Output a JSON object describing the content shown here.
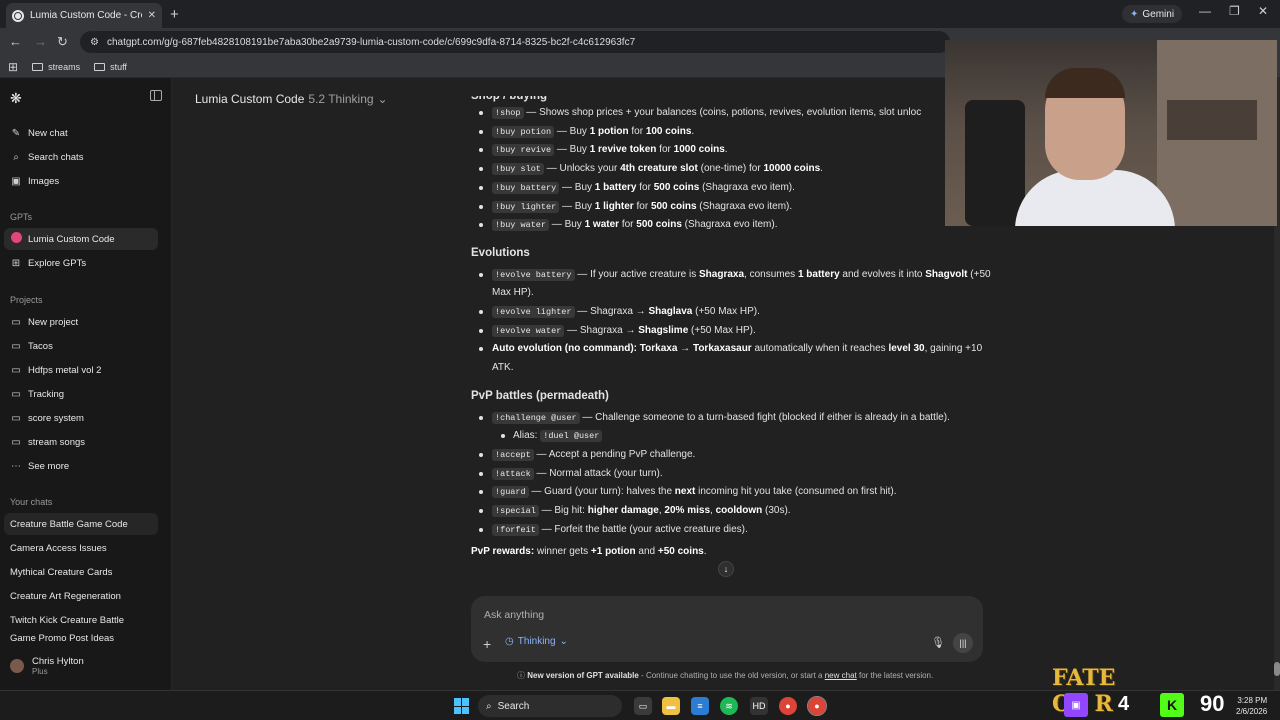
{
  "browser": {
    "tab_title": "Lumia Custom Code - Creature",
    "url": "chatgpt.com/g/g-687feb4828108191be7aba30be2a9739-lumia-custom-code/c/699c9dfa-8714-8325-bc2f-c4c612963fc7",
    "gemini_label": "Gemini",
    "bookmarks": [
      {
        "label": "streams",
        "icon": "folder-icon"
      },
      {
        "label": "stuff",
        "icon": "folder-icon"
      }
    ]
  },
  "sidebar": {
    "top_items": [
      {
        "label": "New chat",
        "icon": "edit-icon"
      },
      {
        "label": "Search chats",
        "icon": "search-icon"
      },
      {
        "label": "Images",
        "icon": "image-icon"
      }
    ],
    "gpts_header": "GPTs",
    "gpts": [
      {
        "label": "Lumia Custom Code",
        "icon": "lumia-icon"
      },
      {
        "label": "Explore GPTs",
        "icon": "grid-icon"
      }
    ],
    "projects_header": "Projects",
    "projects": [
      {
        "label": "New project",
        "icon": "folder-plus-icon"
      },
      {
        "label": "Tacos",
        "icon": "folder-icon"
      },
      {
        "label": "Hdfps metal vol 2",
        "icon": "folder-icon"
      },
      {
        "label": "Tracking",
        "icon": "folder-icon"
      },
      {
        "label": "score system",
        "icon": "folder-icon"
      },
      {
        "label": "stream songs",
        "icon": "folder-icon"
      },
      {
        "label": "See more",
        "icon": "more-icon"
      }
    ],
    "chats_header": "Your chats",
    "chats": [
      "Creature Battle Game Code",
      "Camera Access Issues",
      "Mythical Creature Cards",
      "Creature Art Regeneration",
      "Twitch Kick Creature Battle",
      "Game Promo Post Ideas"
    ],
    "user": {
      "name": "Chris Hylton",
      "plan": "Plus"
    }
  },
  "header": {
    "model_name": "Lumia Custom Code",
    "model_version": "5.2 Thinking"
  },
  "content": {
    "cut_heading": "Shop / buying",
    "shop": [
      {
        "cmd": "!shop",
        "text": " — Shows shop prices + your balances (coins, potions, revives, evolution items, slot unloc"
      },
      {
        "cmd": "!buy potion",
        "pre": " — Buy ",
        "b1": "1 potion",
        "mid": " for ",
        "b2": "100 coins",
        "post": "."
      },
      {
        "cmd": "!buy revive",
        "pre": " — Buy ",
        "b1": "1 revive token",
        "mid": " for ",
        "b2": "1000 coins",
        "post": "."
      },
      {
        "cmd": "!buy slot",
        "pre": " — Unlocks your ",
        "b1": "4th creature slot",
        "mid": " (one-time) for ",
        "b2": "10000 coins",
        "post": "."
      },
      {
        "cmd": "!buy battery",
        "pre": " — Buy ",
        "b1": "1 battery",
        "mid": " for ",
        "b2": "500 coins",
        "post": " (Shagraxa evo item)."
      },
      {
        "cmd": "!buy lighter",
        "pre": " — Buy ",
        "b1": "1 lighter",
        "mid": " for ",
        "b2": "500 coins",
        "post": " (Shagraxa evo item)."
      },
      {
        "cmd": "!buy water",
        "pre": " — Buy ",
        "b1": "1 water",
        "mid": " for ",
        "b2": "500 coins",
        "post": " (Shagraxa evo item)."
      }
    ],
    "evolutions_heading": "Evolutions",
    "evolutions": [
      {
        "cmd": "!evolve battery",
        "pre": " — If your active creature is ",
        "b1": "Shagraxa",
        "mid": ", consumes ",
        "b2": "1 battery",
        "mid2": " and evolves it into ",
        "b3": "Shagvolt",
        "post": " (+50 Max HP)."
      },
      {
        "cmd": "!evolve lighter",
        "pre": " — Shagraxa → ",
        "b1": "Shaglava",
        "post": " (+50 Max HP)."
      },
      {
        "cmd": "!evolve water",
        "pre": " — Shagraxa → ",
        "b1": "Shagslime",
        "post": " (+50 Max HP)."
      },
      {
        "b0": "Auto evolution (no command):",
        "b1": " Torkaxa",
        "arrow": " → ",
        "b2": "Torkaxasaur",
        "mid": " automatically when it reaches ",
        "b3": "level 30",
        "post": ", gaining +10 ATK."
      }
    ],
    "pvp_heading": "PvP battles (permadeath)",
    "pvp": [
      {
        "cmd": "!challenge @user",
        "text": " — Challenge someone to a turn-based fight (blocked if either is already in a battle)."
      },
      {
        "sub": true,
        "label": "Alias: ",
        "cmd": "!duel @user"
      },
      {
        "cmd": "!accept",
        "text": " — Accept a pending PvP challenge."
      },
      {
        "cmd": "!attack",
        "text": " — Normal attack (your turn)."
      },
      {
        "cmd": "!guard",
        "pre": " — Guard (your turn): halves the ",
        "b1": "next",
        "post": " incoming hit you take (consumed on first hit)."
      },
      {
        "cmd": "!special",
        "pre": " — Big hit: ",
        "b1": "higher damage",
        "mid": ", ",
        "b2": "20% miss",
        "mid2": ", ",
        "b3": "cooldown",
        "post": " (30s)."
      },
      {
        "cmd": "!forfeit",
        "text": " — Forfeit the battle (your active creature dies)."
      }
    ],
    "rewards_label": "PvP rewards:",
    "rewards_pre": " winner gets ",
    "rewards_b1": "+1 potion",
    "rewards_mid": " and ",
    "rewards_b2": "+50 coins",
    "rewards_post": "."
  },
  "composer": {
    "placeholder": "Ask anything",
    "mode_label": "Thinking"
  },
  "notice": {
    "bold": "New version of GPT available",
    "text": " - Continue chatting to use the old version, or start a ",
    "link": "new chat",
    "tail": " for the latest version."
  },
  "taskbar": {
    "search_label": "Search",
    "twitch_count": "4",
    "kick_count": "90",
    "overlay_logo_text": "FATE OF R",
    "time": "3:28 PM",
    "date": "2/6/2026"
  }
}
